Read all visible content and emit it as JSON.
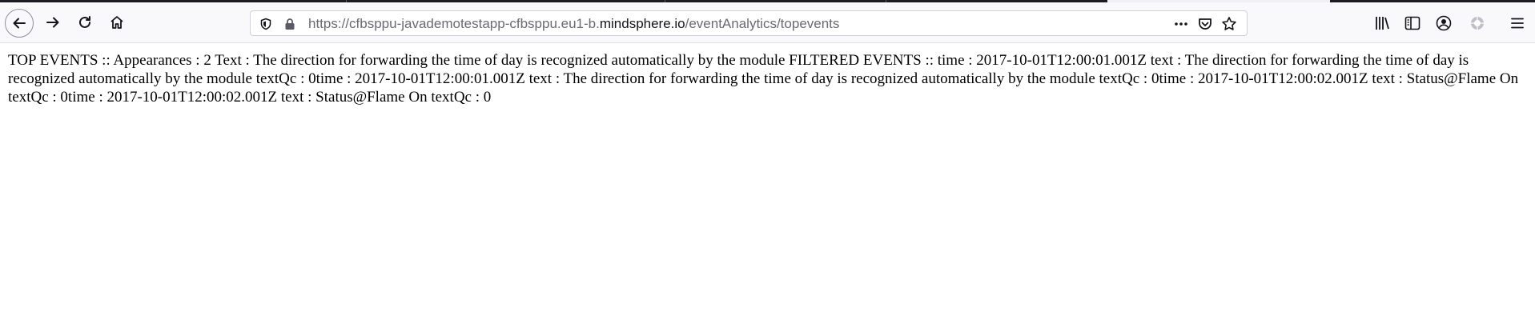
{
  "browser": {
    "url": {
      "prefix": "https://cfbsppu-javademotestapp-cfbsppu.eu1-b.",
      "domain": "mindsphere.io",
      "path": "/eventAnalytics/topevents"
    },
    "icons": {
      "back": "back-arrow-icon",
      "forward": "forward-arrow-icon",
      "reload": "reload-icon",
      "home": "home-icon",
      "tracking": "shield-icon",
      "lock": "lock-icon",
      "more": "more-dots-icon",
      "pocket": "pocket-icon",
      "bookmark": "bookmark-star-icon",
      "library": "library-icon",
      "sidebar": "sidebar-icon",
      "account": "account-icon",
      "extension": "extension-icon",
      "menu": "hamburger-menu-icon"
    },
    "colors": {
      "toolbar": "#f9f9fb",
      "tab_strip": "#1c1b22",
      "url_domain": "#15141a",
      "url_muted": "#6a6a72"
    }
  },
  "page": {
    "body_text": "TOP EVENTS :: Appearances : 2 Text : The direction for forwarding the time of day is recognized automatically by the module FILTERED EVENTS :: time : 2017-10-01T12:00:01.001Z text : The direction for forwarding the time of day is recognized automatically by the module textQc : 0time : 2017-10-01T12:00:01.001Z text : The direction for forwarding the time of day is recognized automatically by the module textQc : 0time : 2017-10-01T12:00:02.001Z text : Status@Flame On textQc : 0time : 2017-10-01T12:00:02.001Z text : Status@Flame On textQc : 0"
  }
}
